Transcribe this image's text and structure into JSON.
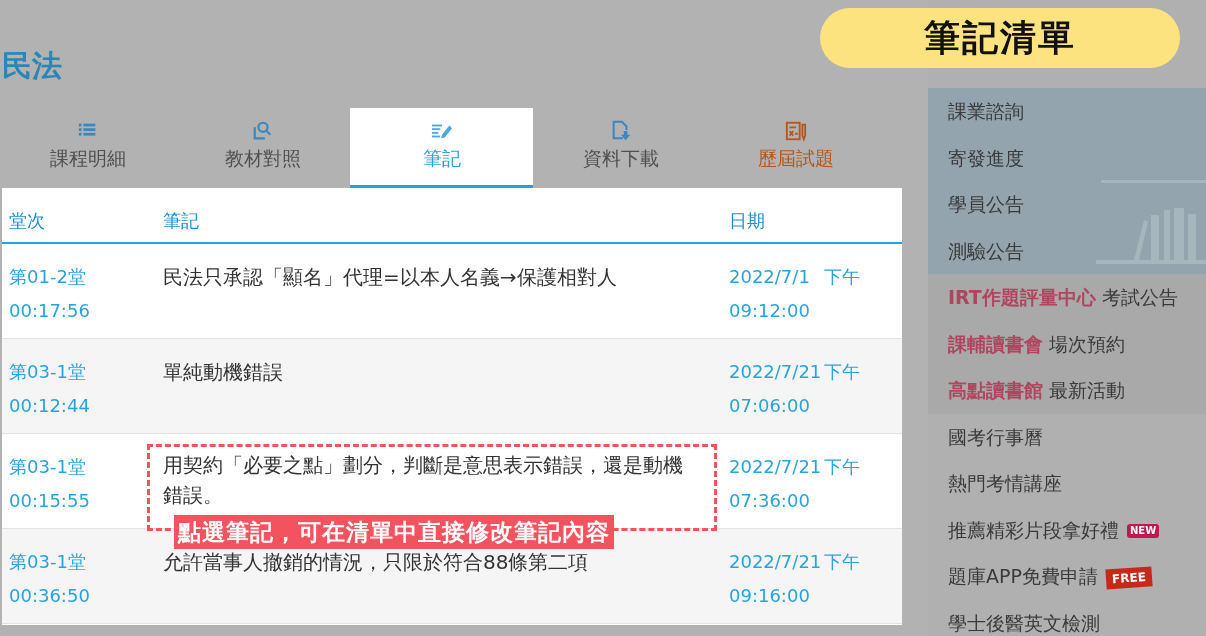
{
  "page_title": "民法",
  "callout_pill": "筆記清單",
  "tabs": [
    {
      "label": "課程明細",
      "selected": false,
      "kind": "normal"
    },
    {
      "label": "教材對照",
      "selected": false,
      "kind": "normal"
    },
    {
      "label": "筆記",
      "selected": true,
      "kind": "normal"
    },
    {
      "label": "資料下載",
      "selected": false,
      "kind": "normal"
    },
    {
      "label": "歷屆試題",
      "selected": false,
      "kind": "exam"
    }
  ],
  "table": {
    "columns": [
      "堂次",
      "筆記",
      "日期"
    ],
    "rows": [
      {
        "lesson": "第01-2堂",
        "time": "00:17:56",
        "note": "民法只承認「顯名」代理=以本人名義→保護相對人",
        "date": "2022/7/1",
        "period": "下午",
        "clock": "09:12:00",
        "highlighted": false
      },
      {
        "lesson": "第03-1堂",
        "time": "00:12:44",
        "note": "單純動機錯誤",
        "date": "2022/7/21",
        "period": "下午",
        "clock": "07:06:00",
        "highlighted": false
      },
      {
        "lesson": "第03-1堂",
        "time": "00:15:55",
        "note": "用契約「必要之點」劃分，判斷是意思表示錯誤，還是動機錯誤。",
        "date": "2022/7/21",
        "period": "下午",
        "clock": "07:36:00",
        "highlighted": true
      },
      {
        "lesson": "第03-1堂",
        "time": "00:36:50",
        "note": "允許當事人撤銷的情況，只限於符合88條第二項",
        "date": "2022/7/21",
        "period": "下午",
        "clock": "09:16:00",
        "highlighted": false
      }
    ]
  },
  "callout_label": "點選筆記，可在清單中直接修改筆記內容",
  "sidebar": {
    "items": [
      {
        "kind": "plain",
        "label": "課業諮詢"
      },
      {
        "kind": "plain",
        "label": "寄發進度"
      },
      {
        "kind": "plain",
        "label": "學員公告"
      },
      {
        "kind": "plain",
        "label": "測驗公告"
      },
      {
        "kind": "brand",
        "brand": "IRT作題評量中心",
        "label": "考試公告"
      },
      {
        "kind": "brand",
        "brand": "課輔讀書會",
        "label": "場次預約"
      },
      {
        "kind": "brand",
        "brand": "高點讀書館",
        "label": "最新活動"
      },
      {
        "kind": "plain",
        "label": "國考行事曆"
      },
      {
        "kind": "plain",
        "label": "熱門考情講座"
      },
      {
        "kind": "plain",
        "label": "推薦精彩片段拿好禮",
        "badge": {
          "kind": "new",
          "text": "NEW"
        }
      },
      {
        "kind": "plain",
        "label": "題庫APP免費申請",
        "badge": {
          "kind": "free",
          "text": "FREE"
        }
      },
      {
        "kind": "plain",
        "label": "學士後醫英文檢測"
      }
    ]
  }
}
